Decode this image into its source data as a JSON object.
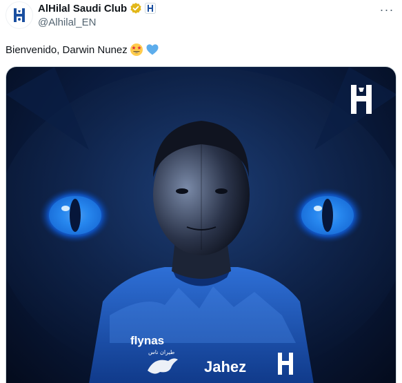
{
  "account": {
    "display_name": "AlHilal Saudi Club",
    "handle": "@Alhilal_EN"
  },
  "tweet": {
    "text": "Bienvenido, Darwin Nunez",
    "emojis": [
      "star-struck",
      "light-blue-heart"
    ]
  },
  "media": {
    "jersey_sponsor": "flynas",
    "jersey_sponsor_arabic": "طيران ناس",
    "jersey_chest_text": "Jahez"
  },
  "colors": {
    "verified_gold": "#e2b719",
    "hilal_blue": "#1a4fa0",
    "text_primary": "#0f1419",
    "text_secondary": "#536471"
  },
  "icons": {
    "verified": "verified-gold-badge",
    "affiliation": "alhilal-logo-badge",
    "more": "more-dots-icon"
  }
}
